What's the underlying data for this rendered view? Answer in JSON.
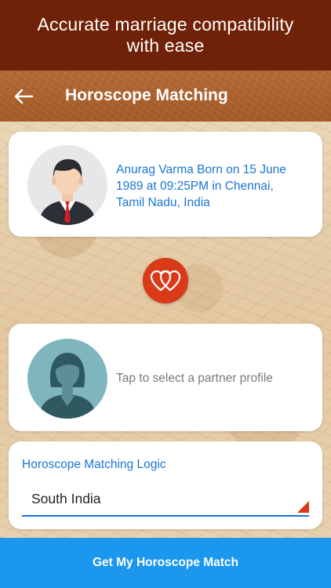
{
  "promo": {
    "text": "Accurate marriage compatibility with ease"
  },
  "appbar": {
    "title": "Horoscope Matching",
    "back_icon": "back-arrow-icon"
  },
  "user_card": {
    "description": "Anurag Varma Born on 15 June 1989 at 09:25PM in Chennai, Tamil Nadu, India",
    "avatar_icon": "male-avatar-icon"
  },
  "match_icon": "hearts-icon",
  "partner_card": {
    "hint": "Tap to select a partner profile",
    "avatar_icon": "female-avatar-icon"
  },
  "logic": {
    "label": "Horoscope Matching Logic",
    "selected": "South India"
  },
  "cta": {
    "label": "Get My Horoscope Match"
  },
  "colors": {
    "promo_bg": "#6f2207",
    "accent_blue": "#1976d2",
    "cta_blue": "#1b97ee",
    "heart_red": "#d93a17"
  }
}
